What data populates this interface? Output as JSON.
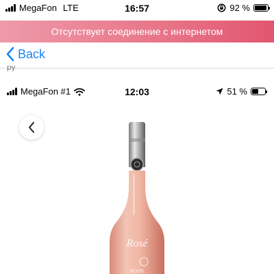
{
  "status_bar": {
    "carrier": "MegaFon",
    "network": "LTE",
    "time": "16:57",
    "battery": "92 %",
    "battery_level": 0.92,
    "signal_icon": "signal-bars-icon",
    "lock_icon": "orientation-lock-icon"
  },
  "banner": {
    "text": "Отсутствует соединение с интернетом",
    "color_start": "#ee9aa9",
    "color_end": "#e1566f"
  },
  "nav": {
    "back_label": "Back",
    "back_icon": "chevron-left-icon",
    "accent": "#1a86f2"
  },
  "cut_text": "ру",
  "inner_status_bar": {
    "carrier": "MegaFon #1",
    "time": "12:03",
    "battery": "51 %",
    "battery_level": 0.51,
    "wifi_icon": "wifi-icon",
    "location_icon": "location-arrow-icon"
  },
  "product": {
    "back_icon": "chevron-left-icon",
    "bottle_label": "Rosé",
    "brand_mark": "BOSIS"
  }
}
